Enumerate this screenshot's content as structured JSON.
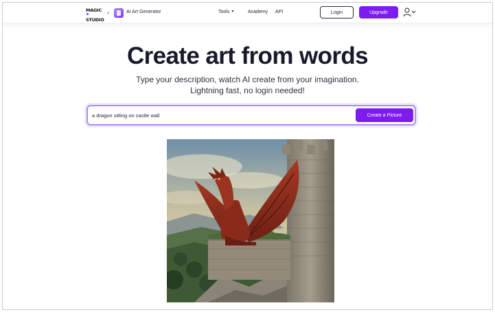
{
  "header": {
    "logo_line1": "MAGIC",
    "logo_line2": "STUDIO",
    "product_name": "AI Art Generator",
    "nav": [
      {
        "label": "Tools",
        "has_dropdown": true
      },
      {
        "label": "Academy"
      },
      {
        "label": "API"
      }
    ],
    "login_label": "Login",
    "upgrade_label": "Upgrade"
  },
  "hero": {
    "title": "Create art from words",
    "subtitle_line1": "Type your description, watch AI create from your imagination.",
    "subtitle_line2": "Lightning fast, no login needed!"
  },
  "prompt": {
    "value": "a dragon sitting on castle wall",
    "button_label": "Create a Picture"
  },
  "colors": {
    "brand_purple": "#7c1cf0",
    "focus_ring": "#a78bfa"
  },
  "icons": {
    "breadcrumb_separator": "chevron-right-icon",
    "dropdown": "chevron-down-icon",
    "user": "user-icon"
  }
}
